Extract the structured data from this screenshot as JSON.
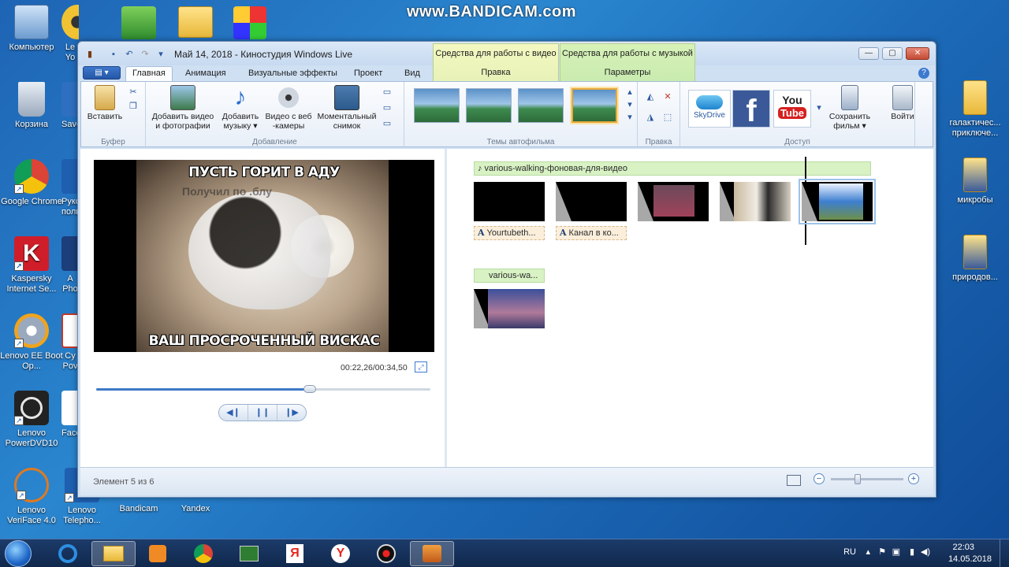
{
  "watermark": "www.BANDICAM.com",
  "desktop": {
    "icons_left": [
      {
        "label": "Компьютер"
      },
      {
        "label": "Корзина"
      },
      {
        "label": "Google Chrome"
      },
      {
        "label": "Kaspersky Internet Se..."
      },
      {
        "label": "Lenovo EE Boot Op..."
      },
      {
        "label": "Lenovo PowerDVD10"
      },
      {
        "label": "Lenovo VeriFace 4.0"
      }
    ],
    "icons_col2": [
      "Le Yo",
      "Save",
      "Руко поль",
      "A Pho",
      "Су Pov",
      "Face",
      "Lenovo Telepho..."
    ],
    "icons_bottom": [
      "Bandicam",
      "Yandex"
    ],
    "icons_right": [
      {
        "label": "галактичес... приключе..."
      },
      {
        "label": "микробы"
      },
      {
        "label": "природов..."
      }
    ]
  },
  "window": {
    "title": "Май 14, 2018 - Киностудия Windows Live",
    "context_video": "Средства для работы с видео",
    "context_music": "Средства для работы с музыкой",
    "context_video_sub": "Правка",
    "context_music_sub": "Параметры",
    "controls": {
      "minimize": "—",
      "maximize": "▢",
      "close": "✕"
    }
  },
  "tabs": {
    "file": "▤ ▾",
    "items": [
      "Главная",
      "Анимация",
      "Визуальные эффекты",
      "Проект",
      "Вид"
    ],
    "help": "?"
  },
  "ribbon": {
    "paste": "Вставить",
    "buffer_label": "Буфер",
    "add_video": "Добавить видео и фотографии",
    "add_music": "Добавить музыку ▾",
    "webcam": "Видео с веб -камеры",
    "snapshot": "Моментальный снимок",
    "add_label": "Добавление",
    "themes_label": "Темы автофильма",
    "edit_label": "Правка",
    "skydrive": "SkyDrive",
    "save_movie": "Сохранить фильм ▾",
    "signin": "Войти",
    "access_label": "Доступ"
  },
  "preview": {
    "caption_top": "ПУСТЬ ГОРИТ В АДУ",
    "caption_faint": "Получил по .блу",
    "caption_bottom": "ВАШ ПРОСРОЧЕННЫЙ ВИСКАС",
    "timecode": "00:22,26/00:34,50",
    "progress": 0.64,
    "transport": [
      "◀❙",
      "❙❙",
      "❙▶"
    ]
  },
  "storyboard": {
    "music_1": "♪ various-walking-фоновая-для-видео",
    "captions": [
      "Yourtubeth...",
      "Канал в ко..."
    ],
    "music_2": "various-wa...",
    "caption_glyph": "A"
  },
  "status": {
    "text": "Элемент 5 из 6",
    "zoom_level": 0.37
  },
  "taskbar": {
    "lang": "RU",
    "time": "22:03",
    "date": "14.05.2018"
  },
  "colors": {
    "accent": "#3d79c6",
    "music_bar": "#d8f2c4",
    "caption_bar": "#fbefdc",
    "selection": "#e7a93b"
  }
}
